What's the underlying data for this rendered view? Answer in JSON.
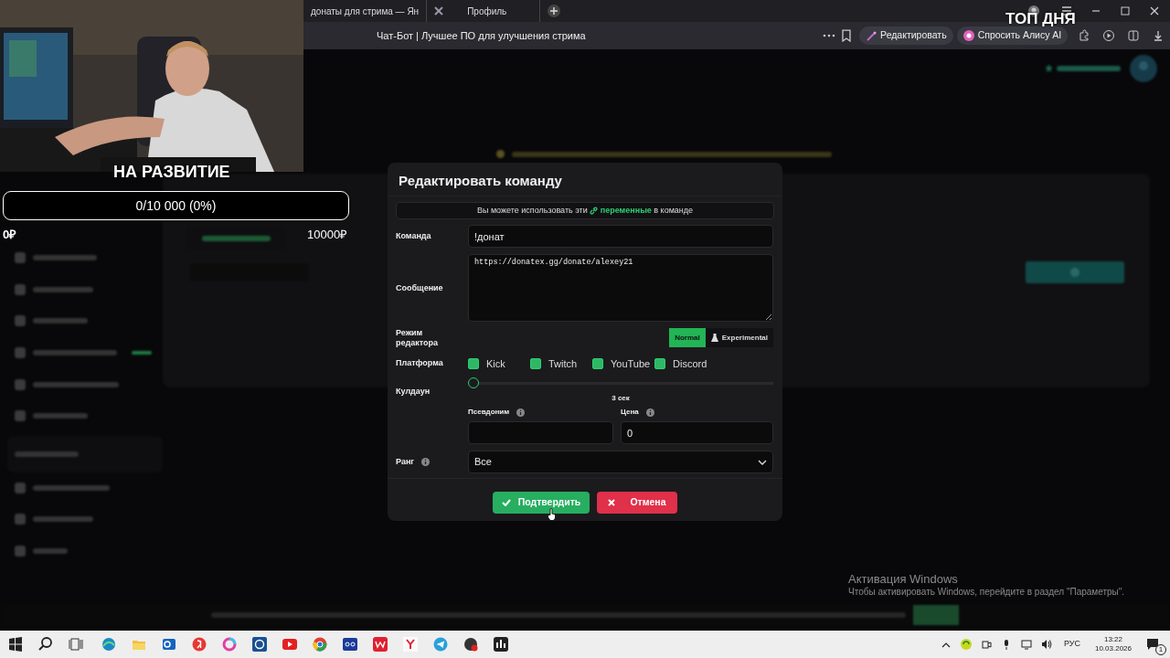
{
  "browser": {
    "tabs": [
      "донаты для стрима — Ян",
      "Профиль"
    ],
    "address": "Чат-Бот | Лучшее ПО для улучшения стрима",
    "toolbar_buttons": [
      "Редактировать",
      "Спросить Алису AI"
    ]
  },
  "stream_overlay": {
    "goal_title": "НА РАЗВИТИЕ",
    "goal_progress": "0/10 000 (0%)",
    "level": 0,
    "goal_min": "0₽",
    "goal_max": "10000₽",
    "top_label": "ТОП ДНЯ"
  },
  "dialog": {
    "title": "Редактировать команду",
    "info": {
      "before": "Вы можете использовать эти",
      "link": "переменные",
      "after": "в команде"
    },
    "command_label": "Команда",
    "command": "!донат",
    "message_label": "Сообщение",
    "message": "https://donatex.gg/donate/alexey21",
    "mode_label": "Режим редактора",
    "modes": [
      {
        "label": "Normal",
        "selected": true
      },
      {
        "label": "Experimental",
        "selected": false
      }
    ],
    "platform_label": "Платформа",
    "platforms": [
      {
        "label": "Kick",
        "checked": true
      },
      {
        "label": "Twitch",
        "checked": true
      },
      {
        "label": "YouTube",
        "checked": true
      },
      {
        "label": "Discord",
        "checked": true
      }
    ],
    "cooldown_label": "Кулдаун",
    "cooldown": {
      "level": 0,
      "reading": "3 сек"
    },
    "alias_label": "Псевдоним",
    "price_label": "Цена",
    "price": "0",
    "rank_label": "Ранг",
    "rank": "Все",
    "confirm": "Подтвердить",
    "cancel": "Отмена"
  },
  "windows_activation": {
    "title": "Активация Windows",
    "text": "Чтобы активировать Windows, перейдите в раздел \"Параметры\"."
  },
  "taskbar": {
    "language": "РУС",
    "time": "13:22",
    "date": "10.03.2026",
    "notifications": "1"
  }
}
